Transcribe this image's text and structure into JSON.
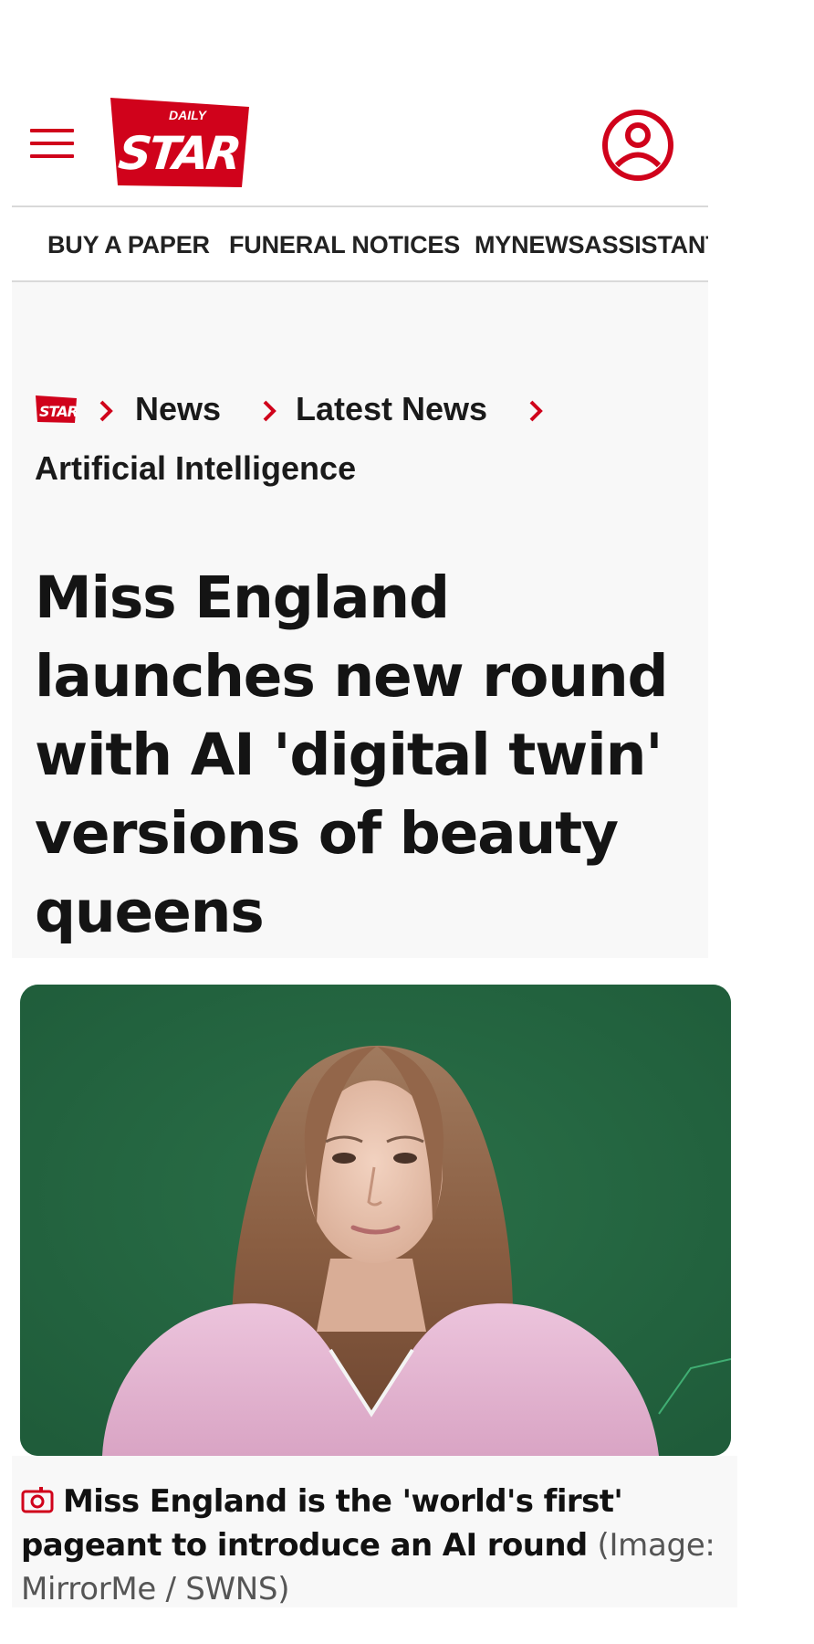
{
  "colors": {
    "brand_red": "#d0021b",
    "text_dark": "#141414",
    "panel_bg": "#f8f8f8",
    "divider": "#d9d9d9",
    "hero_green": "#256b44"
  },
  "header": {
    "menu_icon": "hamburger-menu-icon",
    "logo": {
      "top_text": "DAILY",
      "main_text": "STAR"
    },
    "account_icon": "user-account-icon"
  },
  "nav": {
    "items": [
      {
        "label": "BUY A PAPER"
      },
      {
        "label": "FUNERAL NOTICES"
      },
      {
        "label": "MYNEWSASSISTANT"
      }
    ]
  },
  "breadcrumb": {
    "home_icon": "daily-star-logo-icon",
    "separator_icon": "chevron-right-icon",
    "items": [
      {
        "label": "News"
      },
      {
        "label": "Latest News"
      },
      {
        "label": "Artificial Intelligence"
      }
    ]
  },
  "article": {
    "headline": "Miss England launches new round with AI 'digital twin' versions of beauty queens",
    "hero_image": {
      "subject": "woman with long auburn hair in a pink dress against a green background"
    },
    "caption": {
      "icon": "camera-icon",
      "text": "Miss England is the 'world's first' pageant to introduce an AI round",
      "credit": "(Image: MirrorMe / SWNS)"
    }
  }
}
